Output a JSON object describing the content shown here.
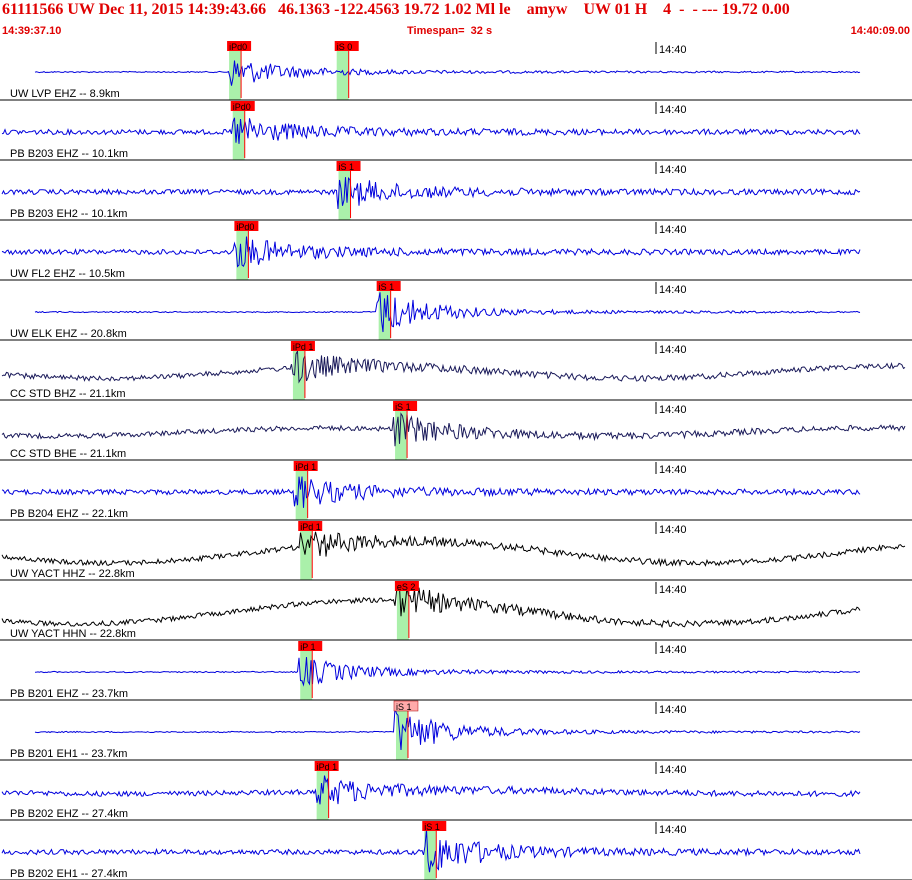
{
  "header": {
    "title": "61111566 UW Dec 11, 2015 14:39:43.66   46.1363 -122.4563 19.72 1.02 Ml le    amyw    UW 01 H    4  -  - --- 19.72 0.00",
    "time_start": "14:39:37.10",
    "timespan": "Timespan=  32 s",
    "time_end": "14:40:09.00"
  },
  "colors": {
    "header_text": "#e00000",
    "trace_blue": "#0000dd",
    "trace_navy": "#1a1a5a",
    "trace_black": "#000000",
    "window_green": "#aaf0aa",
    "pick_red": "#ff0000",
    "pick_pink": "#ffaaaa"
  },
  "time_tick_label": "14:40",
  "traces": [
    {
      "label": "UW LVP EHZ -- 8.9km",
      "color": "blue",
      "picks": [
        {
          "label": "iPd0",
          "t": 0.249,
          "style": "red"
        },
        {
          "label": "iS 0",
          "t": 0.367,
          "style": "red"
        }
      ]
    },
    {
      "label": "PB B203 EHZ -- 10.1km",
      "color": "blue",
      "picks": [
        {
          "label": "iPd0",
          "t": 0.253,
          "style": "red"
        }
      ]
    },
    {
      "label": "PB B203 EH2 -- 10.1km",
      "color": "blue",
      "picks": [
        {
          "label": "iS 1",
          "t": 0.369,
          "style": "red"
        }
      ]
    },
    {
      "label": "UW FL2 EHZ -- 10.5km",
      "color": "blue",
      "picks": [
        {
          "label": "iPd0",
          "t": 0.257,
          "style": "red"
        }
      ]
    },
    {
      "label": "UW ELK EHZ -- 20.8km",
      "color": "blue",
      "picks": [
        {
          "label": "iS 1",
          "t": 0.413,
          "style": "red"
        }
      ]
    },
    {
      "label": "CC STD BHZ -- 21.1km",
      "color": "navy",
      "picks": [
        {
          "label": "iPd 1",
          "t": 0.319,
          "style": "red"
        }
      ]
    },
    {
      "label": "CC STD BHE -- 21.1km",
      "color": "navy",
      "picks": [
        {
          "label": "iS 1",
          "t": 0.431,
          "style": "red"
        }
      ]
    },
    {
      "label": "PB B204 EHZ -- 22.1km",
      "color": "blue",
      "picks": [
        {
          "label": "iPd 1",
          "t": 0.322,
          "style": "red"
        }
      ]
    },
    {
      "label": "UW YACT HHZ -- 22.8km",
      "color": "black",
      "picks": [
        {
          "label": "iPd 1",
          "t": 0.327,
          "style": "red"
        }
      ]
    },
    {
      "label": "UW YACT HHN -- 22.8km",
      "color": "black",
      "picks": [
        {
          "label": "eS 2",
          "t": 0.433,
          "style": "red"
        }
      ]
    },
    {
      "label": "PB B201 EHZ -- 23.7km",
      "color": "blue",
      "picks": [
        {
          "label": "iP 1",
          "t": 0.327,
          "style": "red"
        }
      ]
    },
    {
      "label": "PB B201 EH1 -- 23.7km",
      "color": "blue",
      "picks": [
        {
          "label": "iS 1",
          "t": 0.432,
          "style": "pink"
        }
      ]
    },
    {
      "label": "PB B202 EHZ -- 27.4km",
      "color": "blue",
      "picks": [
        {
          "label": "iPd 1",
          "t": 0.345,
          "style": "red"
        }
      ]
    },
    {
      "label": "PB B202 EH1 -- 27.4km",
      "color": "blue",
      "picks": [
        {
          "label": "iS 1",
          "t": 0.463,
          "style": "red"
        }
      ]
    }
  ]
}
